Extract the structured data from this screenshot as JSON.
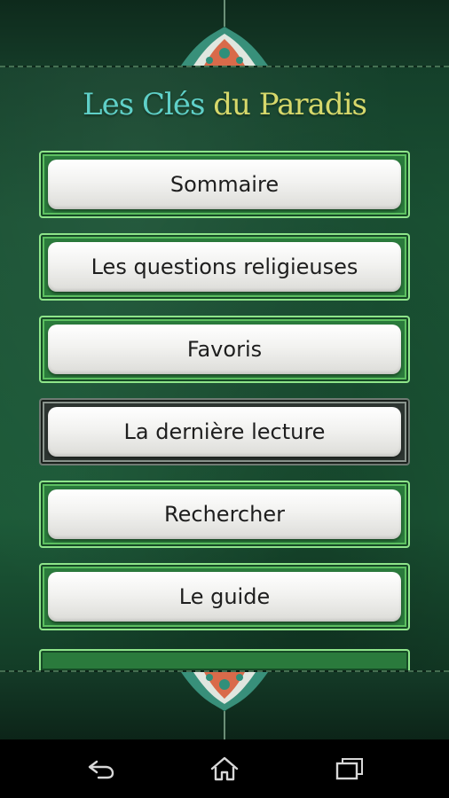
{
  "app": {
    "title_part1": "Les Clés",
    "title_part2": "du Paradis"
  },
  "menu": {
    "items": [
      {
        "label": "Sommaire"
      },
      {
        "label": "Les questions religieuses"
      },
      {
        "label": "Favoris"
      },
      {
        "label": "La dernière lecture",
        "state": "selected"
      },
      {
        "label": "Rechercher"
      },
      {
        "label": "Le guide"
      }
    ]
  },
  "navbar": {
    "icons": [
      "back-icon",
      "home-icon",
      "recent-apps-icon"
    ]
  },
  "colors": {
    "background_green": "#1c5a38",
    "frame_green": "#8ee58a",
    "title_teal": "#5fd0c8",
    "title_gold": "#d6d86b"
  }
}
